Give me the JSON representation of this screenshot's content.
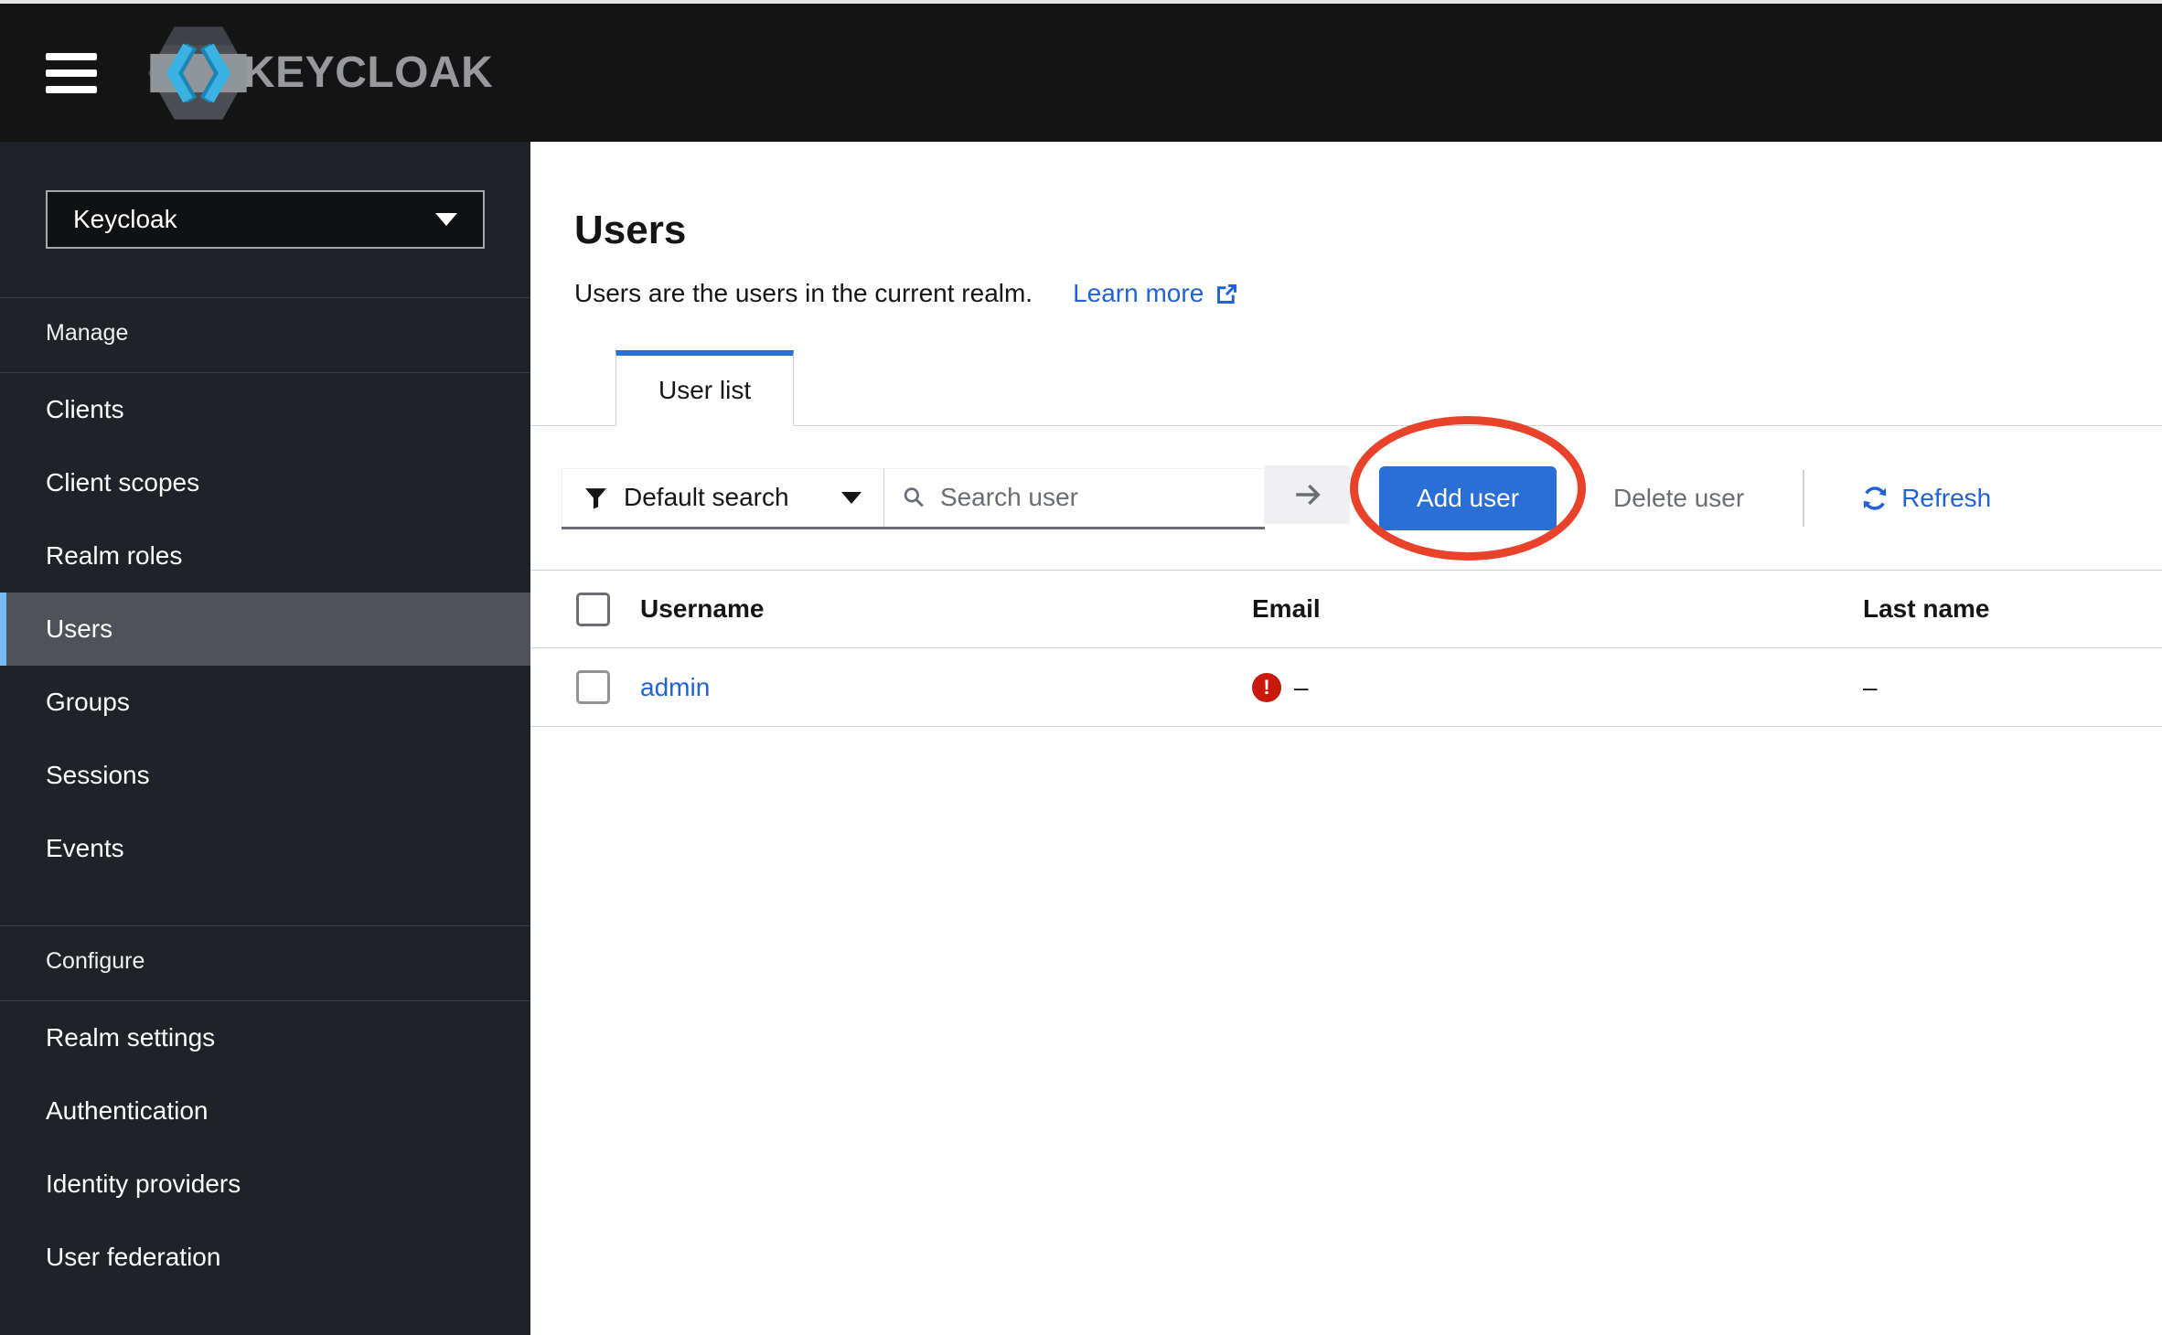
{
  "app": {
    "brand": "KEYCLOAK"
  },
  "sidebar": {
    "realm": {
      "value": "Keycloak"
    },
    "manage": {
      "label": "Manage",
      "items": [
        {
          "label": "Clients"
        },
        {
          "label": "Client scopes"
        },
        {
          "label": "Realm roles"
        },
        {
          "label": "Users"
        },
        {
          "label": "Groups"
        },
        {
          "label": "Sessions"
        },
        {
          "label": "Events"
        }
      ]
    },
    "configure": {
      "label": "Configure",
      "items": [
        {
          "label": "Realm settings"
        },
        {
          "label": "Authentication"
        },
        {
          "label": "Identity providers"
        },
        {
          "label": "User federation"
        }
      ]
    }
  },
  "page": {
    "title": "Users",
    "subtitle": "Users are the users in the current realm.",
    "learn_more_label": "Learn more",
    "tab_user_list": "User list"
  },
  "toolbar": {
    "filter_label": "Default search",
    "search_placeholder": "Search user",
    "add_user_label": "Add user",
    "delete_user_label": "Delete user",
    "refresh_label": "Refresh"
  },
  "table": {
    "columns": {
      "username": "Username",
      "email": "Email",
      "last_name": "Last name"
    },
    "rows": [
      {
        "username": "admin",
        "email_value": "–",
        "last_name_value": "–"
      }
    ]
  },
  "colors": {
    "accent_blue": "#2a6fd6",
    "link_blue": "#2262d4",
    "annotation_red": "#e8432a",
    "warning_red": "#c9190b",
    "nav_selected_accent": "#73bcf7"
  }
}
